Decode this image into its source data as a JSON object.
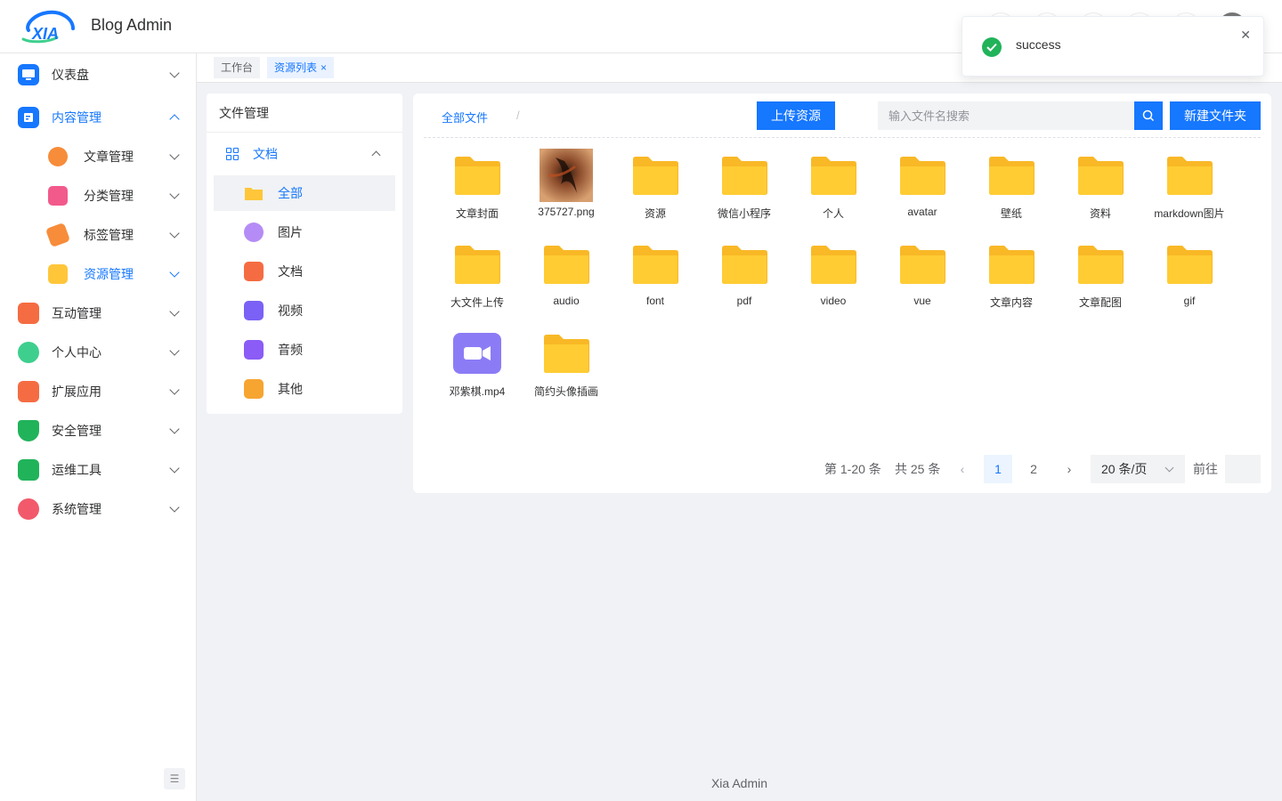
{
  "app": {
    "title": "Blog Admin",
    "logo_text": "XIA"
  },
  "toast": {
    "message": "success"
  },
  "sidebar": {
    "items": [
      {
        "label": "仪表盘",
        "color": "#1677ff"
      },
      {
        "label": "内容管理",
        "color": "#1677ff"
      },
      {
        "label": "互动管理",
        "color": "#f56c42"
      },
      {
        "label": "个人中心",
        "color": "#3ecf8e"
      },
      {
        "label": "扩展应用",
        "color": "#f56c42"
      },
      {
        "label": "安全管理",
        "color": "#21b35a"
      },
      {
        "label": "运维工具",
        "color": "#21b35a"
      },
      {
        "label": "系统管理",
        "color": "#f25a6b"
      }
    ],
    "sub_items": [
      {
        "label": "文章管理",
        "color": "#f78c3a"
      },
      {
        "label": "分类管理",
        "color": "#f25a8b"
      },
      {
        "label": "标签管理",
        "color": "#f78c3a"
      },
      {
        "label": "资源管理",
        "color": "#ffc63a"
      }
    ]
  },
  "tags": [
    {
      "label": "工作台"
    },
    {
      "label": "资源列表",
      "close": "×"
    }
  ],
  "categories": {
    "title": "文件管理",
    "group": "文档",
    "items": [
      {
        "label": "全部",
        "icon": "folder-icon",
        "color": "#ffc63a"
      },
      {
        "label": "图片",
        "icon": "image-icon",
        "color": "#b58cf5"
      },
      {
        "label": "文档",
        "icon": "document-icon",
        "color": "#f56c42"
      },
      {
        "label": "视频",
        "icon": "video-icon",
        "color": "#7b61f5"
      },
      {
        "label": "音频",
        "icon": "audio-icon",
        "color": "#8b5cf6"
      },
      {
        "label": "其他",
        "icon": "other-file-icon",
        "color": "#f7a531"
      }
    ]
  },
  "toolbar": {
    "breadcrumb": "全部文件",
    "separator": "/",
    "upload_label": "上传资源",
    "search_placeholder": "输入文件名搜索",
    "new_folder_label": "新建文件夹"
  },
  "files": [
    {
      "name": "文章封面",
      "type": "folder"
    },
    {
      "name": "375727.png",
      "type": "image"
    },
    {
      "name": "资源",
      "type": "folder"
    },
    {
      "name": "微信小程序",
      "type": "folder"
    },
    {
      "name": "个人",
      "type": "folder"
    },
    {
      "name": "avatar",
      "type": "folder"
    },
    {
      "name": "壁纸",
      "type": "folder"
    },
    {
      "name": "资料",
      "type": "folder"
    },
    {
      "name": "markdown图片",
      "type": "folder"
    },
    {
      "name": "大文件上传",
      "type": "folder"
    },
    {
      "name": "audio",
      "type": "folder"
    },
    {
      "name": "font",
      "type": "folder"
    },
    {
      "name": "pdf",
      "type": "folder"
    },
    {
      "name": "video",
      "type": "folder"
    },
    {
      "name": "vue",
      "type": "folder"
    },
    {
      "name": "文章内容",
      "type": "folder"
    },
    {
      "name": "文章配图",
      "type": "folder"
    },
    {
      "name": "gif",
      "type": "folder"
    },
    {
      "name": "邓紫棋.mp4",
      "type": "video"
    },
    {
      "name": "简约头像插画",
      "type": "folder"
    }
  ],
  "pagination": {
    "range": "第 1-20 条",
    "total": "共 25 条",
    "pages": [
      "1",
      "2"
    ],
    "current": "1",
    "page_size": "20 条/页",
    "goto_label": "前往"
  },
  "footer": "Xia Admin",
  "colors": {
    "primary": "#1677ff",
    "folder": "#ffc63a",
    "success": "#21b35a"
  }
}
